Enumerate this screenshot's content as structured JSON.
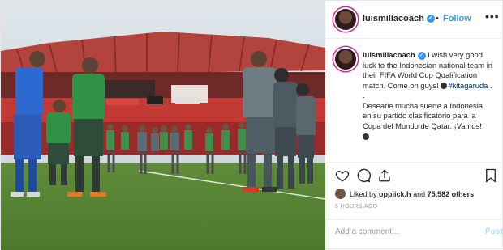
{
  "header": {
    "username": "luismillacoach",
    "verified_glyph": "✓",
    "dot": "•",
    "follow_label": "Follow",
    "more_label": "•••"
  },
  "caption": {
    "username": "luismillacoach",
    "line1": "I wish very good luck to the Indonesian national team in their FIFA World Cup Qualification match. Come on guys!",
    "hashtag": "#kitagaruda",
    "line1_end": ".",
    "dot_line": ".",
    "line2": "Desearle mucha suerte a Indonesia en su partido clasificatorio para la Copa del Mundo de Qatar. ¡Vamos!"
  },
  "likes": {
    "prefix": "Liked by",
    "first_user": "oppiick.h",
    "middle": "and",
    "others": "75,582 others"
  },
  "time": "5 HOURS AGO",
  "comment": {
    "placeholder": "Add a comment…",
    "post_label": "Post"
  },
  "icons": [
    "heart-icon",
    "comment-icon",
    "share-icon",
    "bookmark-icon",
    "verified-icon",
    "more-icon"
  ],
  "colors": {
    "accent": "#3897f0",
    "text": "#262626",
    "muted": "#999999",
    "post_disabled": "#b2dffc"
  }
}
